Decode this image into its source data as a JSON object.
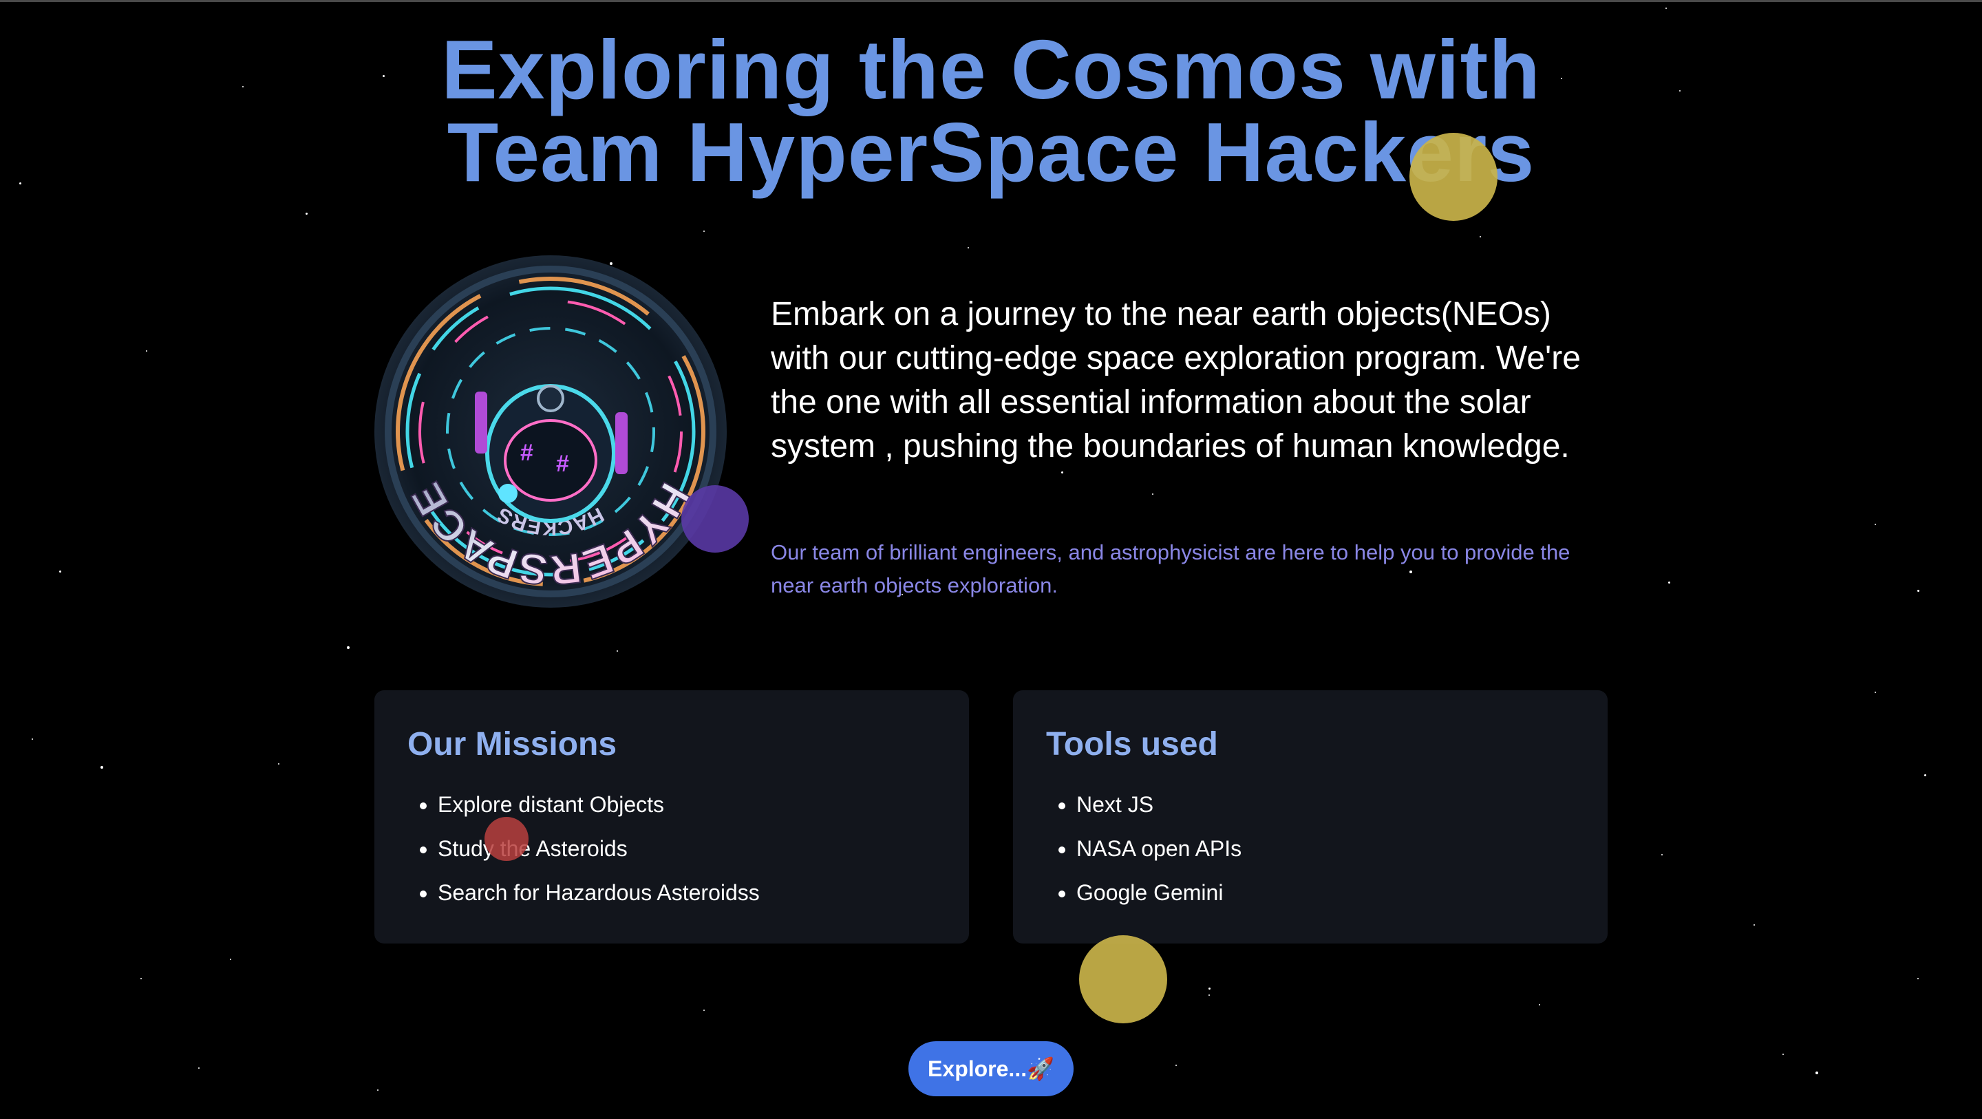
{
  "hero": {
    "title_line1": "Exploring the Cosmos with",
    "title_line2": "Team HyperSpace Hackers",
    "intro": "Embark on a journey to the near earth objects(NEOs) with our cutting-edge space exploration program. We're the one with all essential information about the solar system , pushing the boundaries of human knowledge.",
    "subintro": "Our team of brilliant engineers, and astrophysicist are here to help you to provide the near earth objects exploration.",
    "logo": {
      "icon": "astronaut-badge-logo",
      "text_main": "HYPERSPACE",
      "text_sub": "HACKERS"
    }
  },
  "missions": {
    "heading": "Our Missions",
    "items": [
      "Explore distant Objects",
      "Study the Asteroids",
      "Search for Hazardous Asteroidss"
    ]
  },
  "tools": {
    "heading": "Tools used",
    "items": [
      "Next JS",
      "NASA open APIs",
      "Google Gemini"
    ]
  },
  "cta": {
    "label": "Explore...🚀"
  },
  "colors": {
    "background": "#000000",
    "title": "#6a95e3",
    "subintro": "#8a87e6",
    "card_bg": "#12151c",
    "card_heading": "#8fb0ef",
    "button": "#3f73e6",
    "orb_gold": "#c9b34a",
    "orb_purple": "#5b3aa8",
    "orb_red": "#b8403e"
  }
}
